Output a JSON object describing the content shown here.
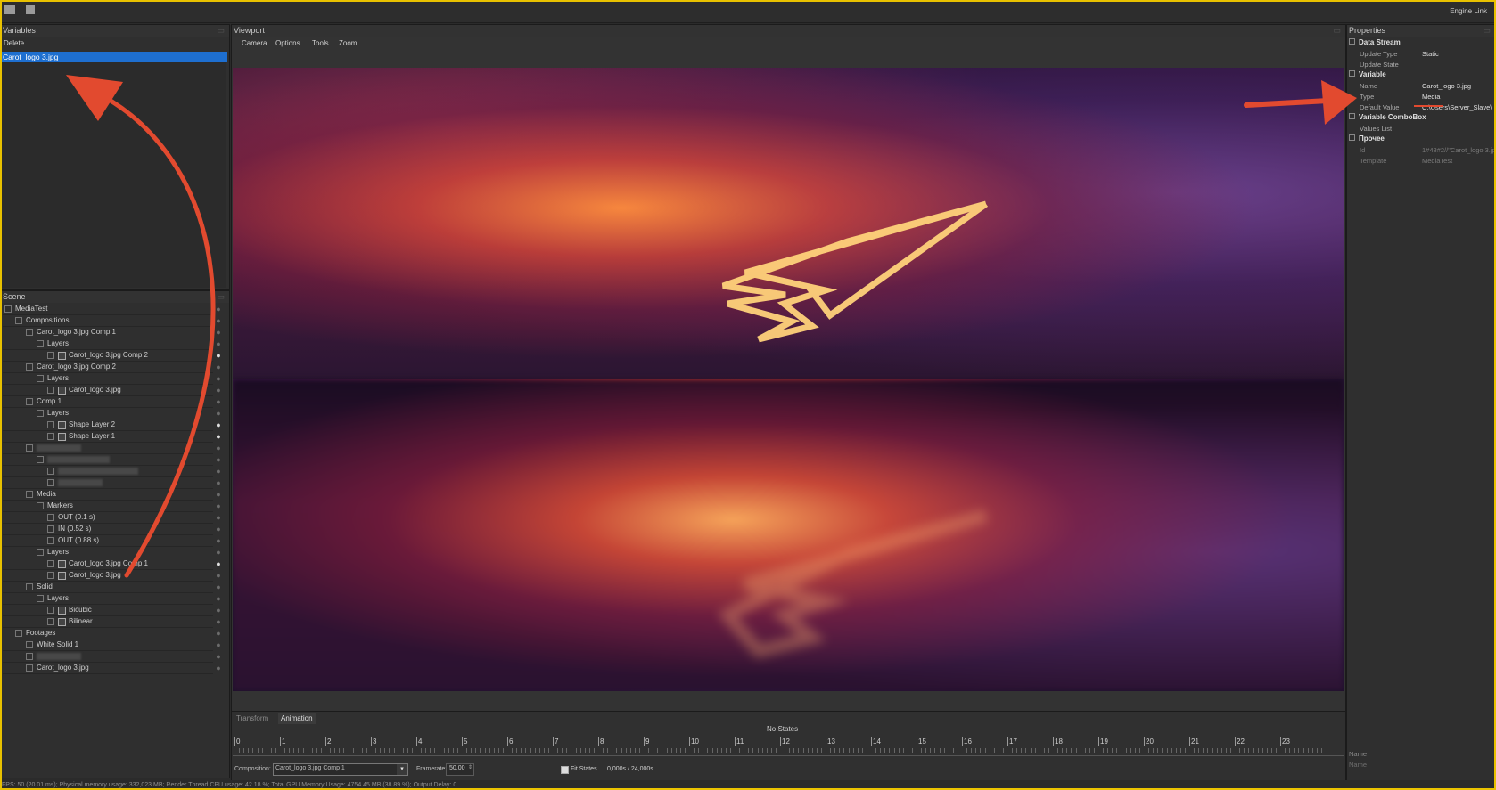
{
  "app": {
    "engine_link": "Engine Link"
  },
  "variables": {
    "title": "Variables",
    "delete_label": "Delete",
    "items": [
      "Carot_logo 3.jpg"
    ]
  },
  "scene": {
    "title": "Scene",
    "rows": [
      {
        "label": "MediaTest",
        "indent": 0,
        "eye": false
      },
      {
        "label": "Compositions",
        "indent": 1,
        "eye": false
      },
      {
        "label": "Carot_logo 3.jpg Comp 1",
        "indent": 2,
        "eye": false
      },
      {
        "label": "Layers",
        "indent": 3,
        "eye": false
      },
      {
        "label": "Carot_logo 3.jpg Comp 2",
        "indent": 4,
        "eye": true,
        "icon": true
      },
      {
        "label": "Carot_logo 3.jpg Comp 2",
        "indent": 2,
        "eye": false
      },
      {
        "label": "Layers",
        "indent": 3,
        "eye": false
      },
      {
        "label": "Carot_logo 3.jpg",
        "indent": 4,
        "eye": false,
        "icon": true
      },
      {
        "label": "Comp 1",
        "indent": 2,
        "eye": false
      },
      {
        "label": "Layers",
        "indent": 3,
        "eye": false
      },
      {
        "label": "Shape Layer 2",
        "indent": 4,
        "eye": true,
        "icon": true
      },
      {
        "label": "Shape Layer 1",
        "indent": 4,
        "eye": true,
        "icon": true
      },
      {
        "label": "",
        "indent": 2,
        "eye": false,
        "blur": true
      },
      {
        "label": "",
        "indent": 3,
        "eye": false,
        "blur": true
      },
      {
        "label": "",
        "indent": 4,
        "eye": false,
        "blur": true
      },
      {
        "label": "",
        "indent": 4,
        "eye": false,
        "blur": true
      },
      {
        "label": "Media",
        "indent": 2,
        "eye": false
      },
      {
        "label": "Markers",
        "indent": 3,
        "eye": false
      },
      {
        "label": "OUT (0.1 s)",
        "indent": 4,
        "eye": false
      },
      {
        "label": "IN (0.52 s)",
        "indent": 4,
        "eye": false
      },
      {
        "label": "OUT (0.88 s)",
        "indent": 4,
        "eye": false
      },
      {
        "label": "Layers",
        "indent": 3,
        "eye": false
      },
      {
        "label": "Carot_logo 3.jpg Comp 1",
        "indent": 4,
        "eye": true,
        "icon": true
      },
      {
        "label": "Carot_logo 3.jpg",
        "indent": 4,
        "eye": false,
        "icon": true
      },
      {
        "label": "Solid",
        "indent": 2,
        "eye": false
      },
      {
        "label": "Layers",
        "indent": 3,
        "eye": false
      },
      {
        "label": "Bicubic",
        "indent": 4,
        "eye": false,
        "icon": true
      },
      {
        "label": "Bilinear",
        "indent": 4,
        "eye": false,
        "icon": true
      },
      {
        "label": "Footages",
        "indent": 1,
        "eye": false
      },
      {
        "label": "White Solid 1",
        "indent": 2,
        "eye": false
      },
      {
        "label": "",
        "indent": 2,
        "eye": false,
        "blur": true
      },
      {
        "label": "Carot_logo 3.jpg",
        "indent": 2,
        "eye": false
      }
    ]
  },
  "viewport": {
    "title": "Viewport",
    "menu": [
      "Camera",
      "Options",
      "Tools",
      "Zoom"
    ]
  },
  "animation": {
    "tabs": [
      "Transform",
      "Animation"
    ],
    "active_tab": "Animation",
    "no_states": "No States",
    "timeline_marks": [
      "0",
      "1",
      "2",
      "3",
      "4",
      "5",
      "6",
      "7",
      "8",
      "9",
      "10",
      "11",
      "12",
      "13",
      "14",
      "15",
      "16",
      "17",
      "18",
      "19",
      "20",
      "21",
      "22",
      "23"
    ],
    "composition_label": "Composition:",
    "composition_value": "Carot_logo 3.jpg Comp 1",
    "framerate_label": "Framerate:",
    "framerate_value": "50,00",
    "fit_states_label": "Fit States",
    "fit_states_checked": true,
    "time_readout": "0,000s / 24,000s"
  },
  "properties": {
    "title": "Properties",
    "groups": [
      {
        "name": "Data Stream",
        "rows": [
          {
            "k": "Update Type",
            "v": "Static"
          },
          {
            "k": "Update State",
            "v": ""
          }
        ]
      },
      {
        "name": "Variable",
        "rows": [
          {
            "k": "Name",
            "v": "Carot_logo 3.jpg"
          },
          {
            "k": "Type",
            "v": "Media"
          },
          {
            "k": "Default Value",
            "v": "C:\\Users\\Server_Slave\\"
          }
        ]
      },
      {
        "name": "Variable ComboBox",
        "rows": [
          {
            "k": "Values List",
            "v": ""
          }
        ]
      },
      {
        "name": "Прочее",
        "rows": [
          {
            "k": "Id",
            "v": "1#48#2//\"Carot_logo 3.jp"
          },
          {
            "k": "Template",
            "v": "MediaTest"
          }
        ]
      }
    ],
    "footer_name": "Name",
    "footer_name_value": "Name"
  },
  "status_bar": "FPS: 50 (20.01 ms); Physical memory usage: 332,023 MB; Render Thread CPU usage: 42.18 %; Total GPU Memory Usage: 4754.45 MB (38.89 %); Output Delay: 0",
  "colors": {
    "accent": "#1e6fd0",
    "annotation": "#e24a2f",
    "frame": "#e8c100"
  }
}
